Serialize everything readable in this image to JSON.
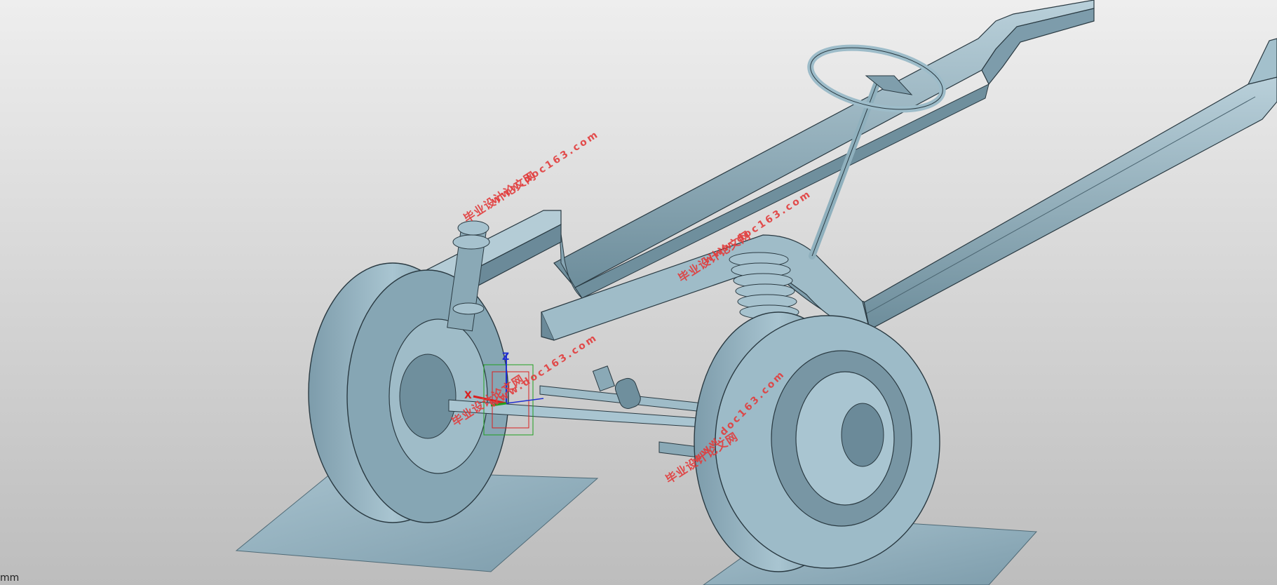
{
  "viewport": {
    "units_label": "mm",
    "background": {
      "top": "#eeeeee",
      "bottom": "#bdbdbd"
    }
  },
  "model": {
    "body_color": "#94b4c1",
    "shadow_color": "#5f7f8c",
    "highlight_color": "#c9dce4",
    "edge_color": "#2a3a42"
  },
  "triad": {
    "x_label": "X",
    "z_label": "Z",
    "x_color": "#d92020",
    "y_color": "#20a020",
    "z_color": "#2030d0"
  },
  "watermarks": [
    {
      "text": "毕业设计论文网",
      "kind": "cn"
    },
    {
      "text": "www.doc163.com",
      "kind": "url"
    },
    {
      "text": "毕业设计论文网",
      "kind": "cn"
    },
    {
      "text": "www.doc163.com",
      "kind": "url"
    },
    {
      "text": "www.doc163.com",
      "kind": "url"
    },
    {
      "text": "毕业设计论文网",
      "kind": "cn"
    },
    {
      "text": "毕业设计论文网",
      "kind": "cn"
    },
    {
      "text": "www.doc163.com",
      "kind": "url"
    }
  ],
  "watermark_color": "#e23c3c"
}
